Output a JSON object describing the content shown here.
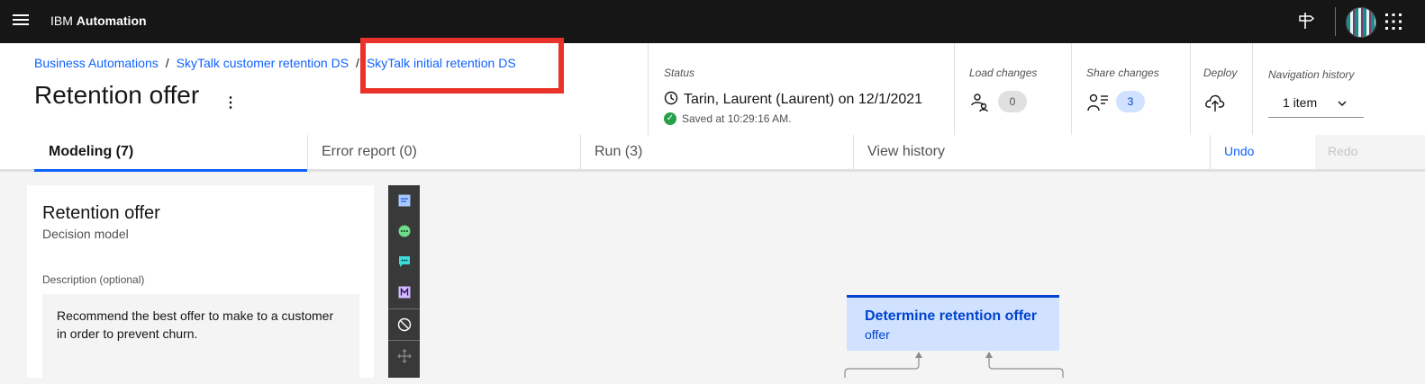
{
  "topbar": {
    "brand_prefix": "IBM",
    "brand_name": "Automation"
  },
  "breadcrumb": [
    {
      "label": "Business Automations"
    },
    {
      "label": "SkyTalk customer retention DS"
    },
    {
      "label": "SkyTalk initial retention DS"
    }
  ],
  "breadcrumb_separator": "/",
  "page_title": "Retention offer",
  "overflow_glyph": "⋮",
  "status": {
    "label": "Status",
    "text": "Tarin, Laurent (Laurent) on 12/1/2021",
    "saved": "Saved at 10:29:16 AM."
  },
  "load_changes": {
    "label": "Load changes",
    "count": "0"
  },
  "share_changes": {
    "label": "Share changes",
    "count": "3"
  },
  "deploy": {
    "label": "Deploy"
  },
  "navigation_history": {
    "label": "Navigation history",
    "value": "1 item"
  },
  "tabs": [
    {
      "label": "Modeling (7)",
      "active": true
    },
    {
      "label": "Error report (0)",
      "active": false
    },
    {
      "label": "Run (3)",
      "active": false
    },
    {
      "label": "View history",
      "active": false
    }
  ],
  "actions": {
    "undo": "Undo",
    "redo": "Redo"
  },
  "side_panel": {
    "title": "Retention offer",
    "subtitle": "Decision model",
    "description_label": "Description (optional)",
    "description": "Recommend the best offer to make to a customer in order to prevent churn."
  },
  "palette_icons": [
    "note-icon",
    "decision-node-icon",
    "comment-node-icon",
    "model-node-icon",
    "disable-icon",
    "move-icon"
  ],
  "node": {
    "title": "Determine retention offer",
    "subtitle": "offer"
  },
  "colors": {
    "topbar": "#161616",
    "link": "#0f62fe",
    "highlight": "#e8322a",
    "node_fill": "#d0e2ff",
    "node_text": "#0043ce",
    "success": "#24a148"
  }
}
